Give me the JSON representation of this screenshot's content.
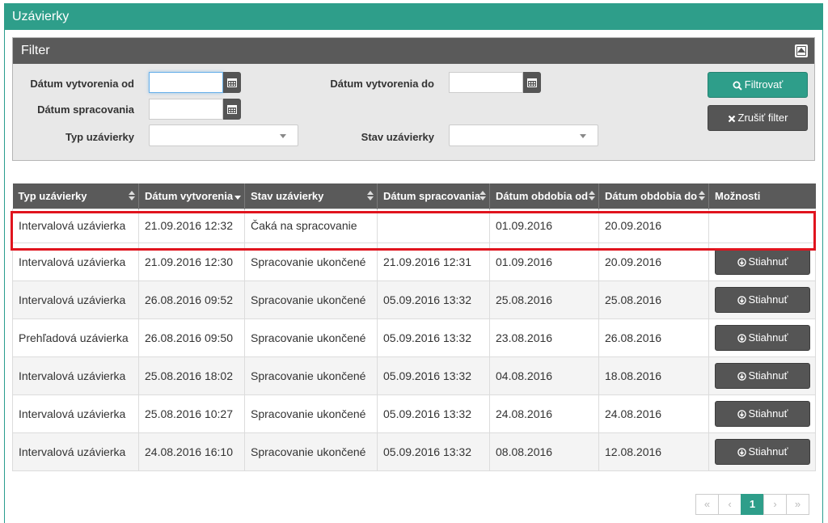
{
  "window": {
    "title": "Uzávierky"
  },
  "filter": {
    "title": "Filter",
    "created_from_label": "Dátum vytvorenia od",
    "created_to_label": "Dátum vytvorenia do",
    "processed_label": "Dátum spracovania",
    "type_label": "Typ uzávierky",
    "state_label": "Stav uzávierky",
    "created_from_value": "",
    "created_to_value": "",
    "processed_value": "",
    "type_value": "",
    "state_value": "",
    "filter_button": "Filtrovať",
    "clear_button": "Zrušiť filter"
  },
  "table": {
    "columns": [
      "Typ uzávierky",
      "Dátum vytvorenia",
      "Stav uzávierky",
      "Dátum spracovania",
      "Dátum obdobia od",
      "Dátum obdobia do",
      "Možnosti"
    ],
    "download_label": "Stiahnuť",
    "rows": [
      {
        "type": "Intervalová uzávierka",
        "created": "21.09.2016 12:32",
        "state": "Čaká na spracovanie",
        "processed": "",
        "from": "01.09.2016",
        "to": "20.09.2016",
        "download": false
      },
      {
        "type": "Intervalová uzávierka",
        "created": "21.09.2016 12:30",
        "state": "Spracovanie ukončené",
        "processed": "21.09.2016 12:31",
        "from": "01.09.2016",
        "to": "20.09.2016",
        "download": true
      },
      {
        "type": "Intervalová uzávierka",
        "created": "26.08.2016 09:52",
        "state": "Spracovanie ukončené",
        "processed": "05.09.2016 13:32",
        "from": "25.08.2016",
        "to": "25.08.2016",
        "download": true
      },
      {
        "type": "Prehľadová uzávierka",
        "created": "26.08.2016 09:50",
        "state": "Spracovanie ukončené",
        "processed": "05.09.2016 13:32",
        "from": "23.08.2016",
        "to": "26.08.2016",
        "download": true
      },
      {
        "type": "Intervalová uzávierka",
        "created": "25.08.2016 18:02",
        "state": "Spracovanie ukončené",
        "processed": "05.09.2016 13:32",
        "from": "04.08.2016",
        "to": "18.08.2016",
        "download": true
      },
      {
        "type": "Intervalová uzávierka",
        "created": "25.08.2016 10:27",
        "state": "Spracovanie ukončené",
        "processed": "05.09.2016 13:32",
        "from": "24.08.2016",
        "to": "24.08.2016",
        "download": true
      },
      {
        "type": "Intervalová uzávierka",
        "created": "24.08.2016 16:10",
        "state": "Spracovanie ukončené",
        "processed": "05.09.2016 13:32",
        "from": "08.08.2016",
        "to": "12.08.2016",
        "download": true
      }
    ]
  },
  "pagination": {
    "first": "«",
    "prev": "‹",
    "current": "1",
    "next": "›",
    "last": "»"
  },
  "colors": {
    "accent": "#2e9e8a",
    "header_dark": "#5a5a5a",
    "highlight": "#e0141e"
  }
}
